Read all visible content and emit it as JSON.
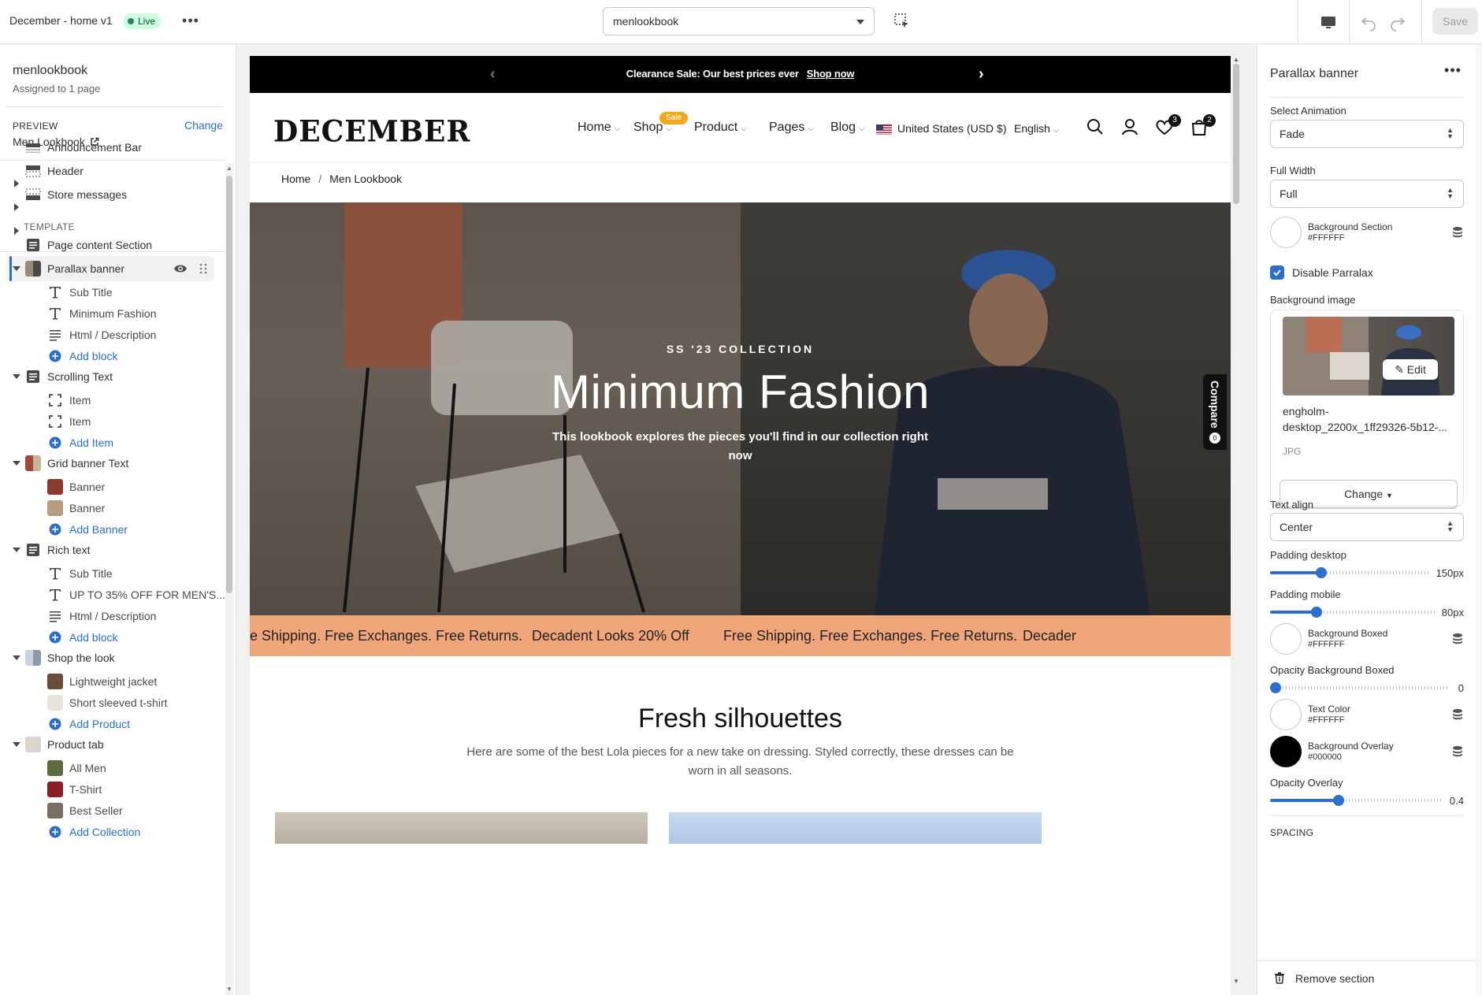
{
  "topbar": {
    "title": "December - home v1",
    "status": "Live",
    "template_select": "menlookbook",
    "save_label": "Save"
  },
  "sidebar": {
    "template_name": "menlookbook",
    "assigned": "Assigned to 1 page",
    "preview_label": "PREVIEW",
    "preview_change": "Change",
    "preview_page": "Men Lookbook",
    "template_label": "TEMPLATE",
    "header_sections": [
      "Announcement Bar",
      "Header",
      "Store messages"
    ],
    "page_content": "Page content Section",
    "parallax": {
      "label": "Parallax banner",
      "children": [
        "Sub Title",
        "Minimum Fashion",
        "Html / Description"
      ],
      "add": "Add block"
    },
    "scrolling": {
      "label": "Scrolling Text",
      "children": [
        "Item",
        "Item"
      ],
      "add": "Add Item"
    },
    "grid": {
      "label": "Grid banner Text",
      "children": [
        "Banner",
        "Banner"
      ],
      "add": "Add Banner"
    },
    "rich": {
      "label": "Rich text",
      "children": [
        "Sub Title",
        "UP TO 35% OFF FOR MEN'S...",
        "Html / Description"
      ],
      "add": "Add block"
    },
    "shop": {
      "label": "Shop the look",
      "children": [
        "Lightweight jacket",
        "Short sleeved t-shirt"
      ],
      "add": "Add Product"
    },
    "product": {
      "label": "Product tab",
      "children": [
        "All Men",
        "T-Shirt",
        "Best Seller"
      ],
      "add": "Add Collection"
    }
  },
  "preview": {
    "announcement": "Clearance Sale: Our best prices ever",
    "announcement_link": "Shop now",
    "logo": "DECEMBER",
    "nav": [
      "Home",
      "Shop",
      "Product",
      "Pages",
      "Blog"
    ],
    "sale_badge": "Sale",
    "currency": "United States (USD $)",
    "language": "English",
    "wishlist_count": "3",
    "cart_count": "2",
    "breadcrumb_home": "Home",
    "breadcrumb_sep": "/",
    "breadcrumb_current": "Men Lookbook",
    "hero_subtitle": "SS '23 COLLECTION",
    "hero_title": "Minimum Fashion",
    "hero_desc": "This lookbook explores the pieces you'll find in our collection right now",
    "compare_label": "Compare",
    "compare_count": "0",
    "marquee": [
      "e Shipping. Free Exchanges. Free Returns.",
      "Decadent Looks 20% Off",
      "Free Shipping. Free Exchanges. Free Returns.",
      "Decader"
    ],
    "section_title": "Fresh silhouettes",
    "section_desc": "Here are some of the best Lola pieces for a new take on dressing. Styled correctly, these dresses can be worn in all seasons."
  },
  "settings": {
    "title": "Parallax banner",
    "animation_label": "Select Animation",
    "animation_value": "Fade",
    "fullwidth_label": "Full Width",
    "fullwidth_value": "Full",
    "bg_section_label": "Background Section",
    "bg_section_hex": "#FFFFFF",
    "disable_parallax": "Disable Parralax",
    "bg_image_label": "Background image",
    "edit_label": "Edit",
    "file_name": "engholm-desktop_2200x_1ff29326-5b12-...",
    "file_type": "JPG",
    "change_label": "Change",
    "text_align_label": "Text align",
    "text_align_value": "Center",
    "padding_desktop_label": "Padding desktop",
    "padding_desktop_value": "150px",
    "padding_desktop_level": 0.32,
    "padding_mobile_label": "Padding mobile",
    "padding_mobile_value": "80px",
    "padding_mobile_level": 0.28,
    "bg_boxed_label": "Background Boxed",
    "bg_boxed_hex": "#FFFFFF",
    "opacity_boxed_label": "Opacity Background Boxed",
    "opacity_boxed_value": "0",
    "opacity_boxed_level": 0,
    "text_color_label": "Text Color",
    "text_color_hex": "#FFFFFF",
    "overlay_label": "Background Overlay",
    "overlay_hex": "#000000",
    "opacity_overlay_label": "Opacity Overlay",
    "opacity_overlay_value": "0.4",
    "opacity_overlay_level": 0.4,
    "spacing_label": "SPACING",
    "remove_label": "Remove section"
  },
  "colors": {
    "accent": "#2c6ecb",
    "marquee_bg": "#f0a57a",
    "live_bg": "#cdfee1"
  }
}
